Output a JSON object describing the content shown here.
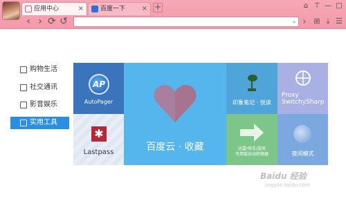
{
  "browser": {
    "tabs": [
      {
        "label": "应用中心",
        "active": true
      },
      {
        "label": "百度一下",
        "active": false
      }
    ],
    "new_tab": "+",
    "nav": {
      "back": "‹",
      "forward": "›",
      "refresh": "⟳",
      "undo": "↺",
      "go": "›"
    },
    "window_controls": [
      "⌂",
      "⊤",
      "—",
      "□"
    ],
    "toolbar": [
      "⊞",
      "⤓",
      "☰"
    ]
  },
  "sidebar": {
    "items": [
      {
        "label": "购物生活",
        "icon": "cart-icon",
        "active": false
      },
      {
        "label": "社交通讯",
        "icon": "chat-icon",
        "active": false
      },
      {
        "label": "影音娱乐",
        "icon": "play-icon",
        "active": false
      },
      {
        "label": "实用工具",
        "icon": "toolbox-icon",
        "active": true
      }
    ]
  },
  "apps": {
    "autopager": {
      "label": "AutoPager",
      "logo": "AP"
    },
    "lastpass": {
      "label": "Lastpass",
      "logo": "✱"
    },
    "baidu_cloud": {
      "label": "百度云 · 收藏"
    },
    "evernote": {
      "label": "印象笔记 · 悦读"
    },
    "proxy": {
      "line1": "Proxy",
      "line2": "SwitchySharp"
    },
    "mouse_gesture": {
      "line1": "迅雷/快车/旋风",
      "line2": "专用链自动转换器"
    },
    "night_mode": {
      "label": "夜间模式"
    }
  },
  "watermark": {
    "brand": "Baidu 经验",
    "url": "jingyan.baidu.com"
  },
  "colors": {
    "chrome": "#f39aaa",
    "accent": "#2a8fe4",
    "baidu_tile": "#54b6ec"
  }
}
